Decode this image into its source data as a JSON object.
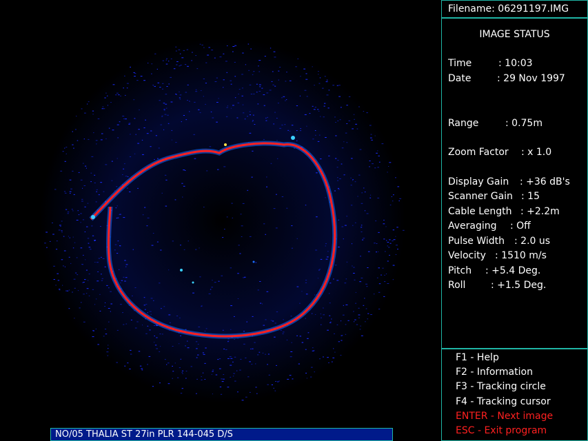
{
  "filename": "Filename: 06291197.IMG",
  "status": {
    "title": "IMAGE STATUS",
    "rows": [
      {
        "label": "Time",
        "value": ": 10:03"
      },
      {
        "label": "Date",
        "value": ": 29 Nov 1997"
      },
      {
        "label": "Range",
        "value": ":  0.75m"
      },
      {
        "label": "Zoom Factor",
        "value": ": x 1.0"
      },
      {
        "label": "Display Gain",
        "value": ":  +36 dB's"
      },
      {
        "label": "Scanner Gain",
        "value": ":  15"
      },
      {
        "label": "Cable Length",
        "value": ":  +2.2m"
      },
      {
        "label": "Averaging",
        "value": ":  Off"
      },
      {
        "label": "Pulse Width",
        "value": ":  2.0 us"
      },
      {
        "label": "Velocity",
        "value": ":  1510 m/s"
      },
      {
        "label": "Pitch",
        "value": ":  +5.4  Deg."
      },
      {
        "label": "Roll",
        "value": ":  +1.5  Deg."
      }
    ]
  },
  "keys": [
    {
      "text": "F1 - Help",
      "color": "#ffffff"
    },
    {
      "text": "F2 - Information",
      "color": "#ffffff"
    },
    {
      "text": "F3 - Tracking circle",
      "color": "#ffffff"
    },
    {
      "text": "F4 - Tracking cursor",
      "color": "#ffffff"
    },
    {
      "text": "ENTER - Next image",
      "color": "#ff2020"
    },
    {
      "text": "ESC - Exit program",
      "color": "#ff2020"
    }
  ],
  "caption": "NO/05 THALIA ST 27in PLR 144-045 D/S",
  "colors": {
    "border": "#1fb6a6",
    "caption_bg": "#001a8a",
    "echo": "#ff2020",
    "noise": "#1a2cff"
  }
}
